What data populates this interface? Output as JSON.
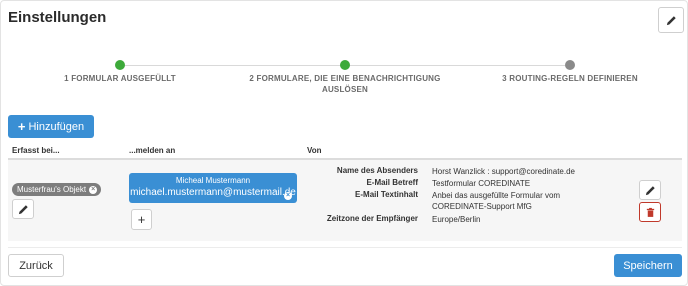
{
  "header": {
    "title": "Einstellungen"
  },
  "stepper": {
    "steps": [
      {
        "label": "1  FORMULAR AUSGEFÜLLT",
        "status": "done"
      },
      {
        "label_line1": "2  FORMULARE, DIE EINE BENACHRICHTIGUNG",
        "label_line2": "AUSLÖSEN",
        "status": "done"
      },
      {
        "label": "3  ROUTING-REGELN DEFINIEREN",
        "status": "pending"
      }
    ],
    "colors": {
      "done": "#3daa3a",
      "pending": "#8a8a8a"
    }
  },
  "toolbar": {
    "add_label": "Hinzufügen"
  },
  "table": {
    "headers": {
      "captured_at": "Erfasst bei...",
      "report_to": "...melden an",
      "from": "Von"
    },
    "row": {
      "object_chip": "Musterfrau's Objekt",
      "recipient": {
        "name": "Micheal Mustermann",
        "email": "michael.mustermann@mustermail.de"
      },
      "from_fields": [
        {
          "key": "Name des Absenders",
          "value": "Horst Wanzlick : support@coredinate.de"
        },
        {
          "key": "E-Mail Betreff",
          "value": "Testformular COREDINATE"
        },
        {
          "key": "E-Mail Textinhalt",
          "value": "Anbei das ausgefüllte Formular vom",
          "value2": "COREDINATE-Support MfG"
        },
        {
          "key": "Zeitzone der Empfänger",
          "value": "Europe/Berlin"
        }
      ]
    }
  },
  "footer": {
    "back_label": "Zurück",
    "save_label": "Speichern"
  },
  "colors": {
    "primary": "#3a8fd4",
    "danger": "#c0392b"
  }
}
